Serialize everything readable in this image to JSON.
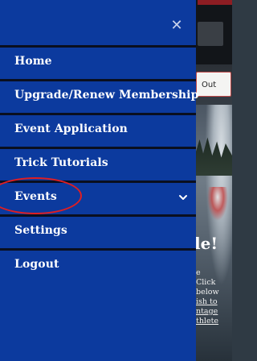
{
  "drawer": {
    "close_icon": "close-icon",
    "close_glyph": "✕",
    "menu_items": [
      {
        "label": "Home"
      },
      {
        "label": "Upgrade/Renew Membership"
      },
      {
        "label": "Event Application"
      },
      {
        "label": "Trick Tutorials"
      },
      {
        "label": "Events",
        "has_submenu": true,
        "icon": "chevron-down-icon"
      },
      {
        "label": "Settings"
      },
      {
        "label": "Logout"
      }
    ],
    "background_color": "#0c3a9e",
    "divider_color": "#0a0f1f"
  },
  "background_page": {
    "logout_button_label": "Out",
    "headline": "le!",
    "body_lines": [
      "e",
      "Click",
      "below",
      "ish to",
      "ntage",
      "thlete"
    ],
    "body_link_lines": [
      "ish to",
      "ntage",
      "thlete"
    ]
  },
  "annotation": {
    "circle_color": "#e01e22",
    "target": "Events"
  }
}
